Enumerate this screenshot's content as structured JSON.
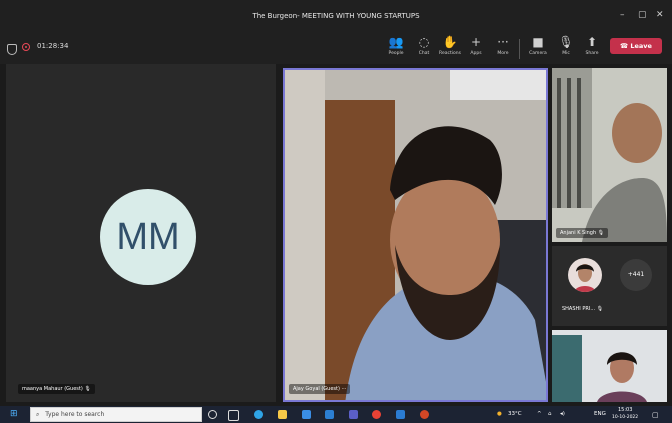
{
  "window": {
    "title": "The Burgeon- MEETING WITH YOUNG STARTUPS",
    "controls": [
      "–",
      "▢",
      "✕"
    ]
  },
  "meeting": {
    "timer": "01:28:34"
  },
  "toolbar": {
    "buttons": [
      {
        "label": "People",
        "icon": "people-icon",
        "glyph": "👥"
      },
      {
        "label": "Chat",
        "icon": "chat-icon",
        "glyph": "◌"
      },
      {
        "label": "Reactions",
        "icon": "reactions-icon",
        "glyph": "✋"
      },
      {
        "label": "Apps",
        "icon": "apps-icon",
        "glyph": "+"
      },
      {
        "label": "More",
        "icon": "more-icon",
        "glyph": "···"
      },
      {
        "label": "Camera",
        "icon": "camera-icon",
        "glyph": "■"
      },
      {
        "label": "Mic",
        "icon": "mic-icon",
        "glyph": "🎙"
      },
      {
        "label": "Share",
        "icon": "share-icon",
        "glyph": "⬆"
      }
    ],
    "leave_label": "Leave",
    "leave_color": "#c4314b"
  },
  "participants": {
    "left_tile": {
      "initials": "MM",
      "name": "maanya Mahaur (Guest)"
    },
    "main_tile": {
      "name": "Ajay Goyal (Guest)"
    },
    "right_top": {
      "name": "Anjani K Singh"
    },
    "right_mid": {
      "name": "SHASHI PRI...",
      "more_count": "+441"
    },
    "accent_border": "#7a78d4"
  },
  "taskbar": {
    "search_placeholder": "Type here to search",
    "weather": "33°C",
    "language": "ENG",
    "time": "15:03",
    "date": "10-10-2022"
  }
}
